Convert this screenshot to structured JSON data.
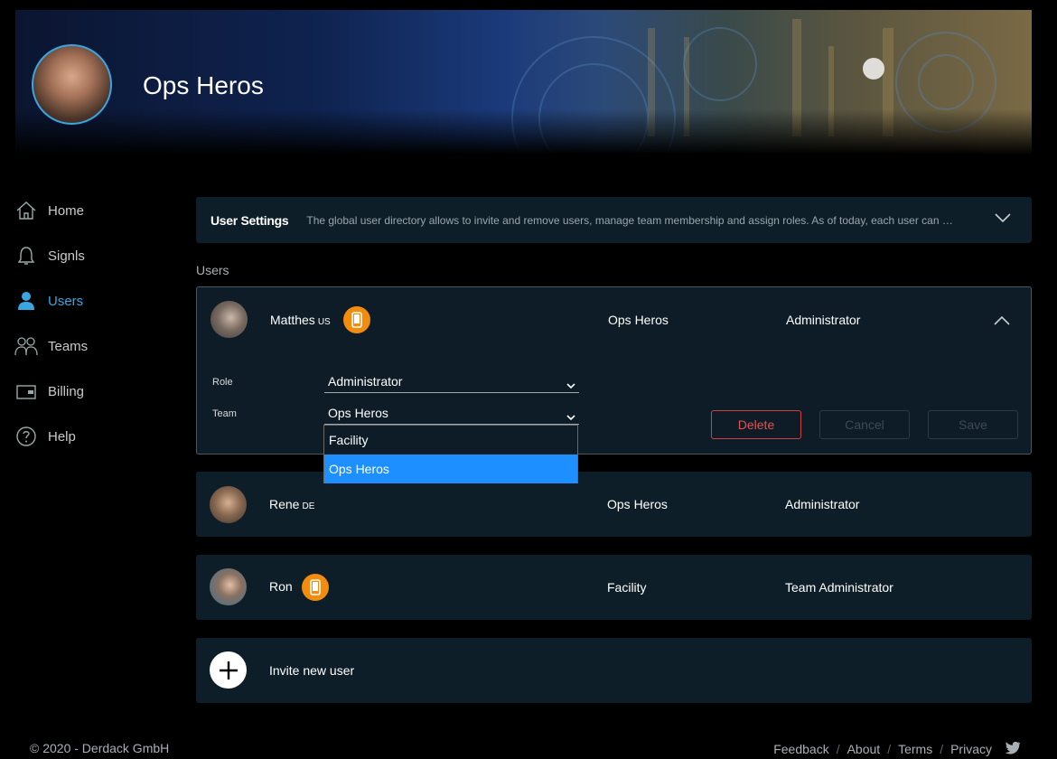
{
  "header": {
    "team_name": "Ops Heros",
    "avatar_icon": "user-avatar-photo"
  },
  "sidebar": {
    "items": [
      {
        "label": "Home",
        "icon": "home-icon"
      },
      {
        "label": "Signls",
        "icon": "bell-icon"
      },
      {
        "label": "Users",
        "icon": "user-icon",
        "active": true
      },
      {
        "label": "Teams",
        "icon": "teams-icon"
      },
      {
        "label": "Billing",
        "icon": "wallet-icon"
      },
      {
        "label": "Help",
        "icon": "help-icon"
      }
    ],
    "active_color": "#3aa6e0"
  },
  "settings": {
    "title": "User Settings",
    "description": "The global user directory allows to invite and remove users, manage team membership and assign roles. As of today, each user can …"
  },
  "users_section_label": "Users",
  "users": [
    {
      "name": "Matthes",
      "country": "US",
      "has_mobile": true,
      "team": "Ops Heros",
      "role": "Administrator",
      "expanded": true
    },
    {
      "name": "Rene",
      "country": "DE",
      "has_mobile": false,
      "team": "Ops Heros",
      "role": "Administrator",
      "expanded": false
    },
    {
      "name": "Ron",
      "country": "",
      "has_mobile": true,
      "team": "Facility",
      "role": "Team Administrator",
      "expanded": false
    }
  ],
  "edit_form": {
    "role_label": "Role",
    "role_value": "Administrator",
    "team_label": "Team",
    "team_value": "Ops Heros",
    "team_options": [
      "Facility",
      "Ops Heros"
    ],
    "delete_label": "Delete",
    "cancel_label": "Cancel",
    "save_label": "Save"
  },
  "invite_label": "Invite new user",
  "footer": {
    "copyright": "© 2020 - Derdack GmbH",
    "links": [
      "Feedback",
      "About",
      "Terms",
      "Privacy"
    ]
  },
  "colors": {
    "badge": "#f28c0f",
    "delete": "#e85050",
    "dropdown_selected": "#1e8fff",
    "card_bg": "#0e1e28"
  }
}
